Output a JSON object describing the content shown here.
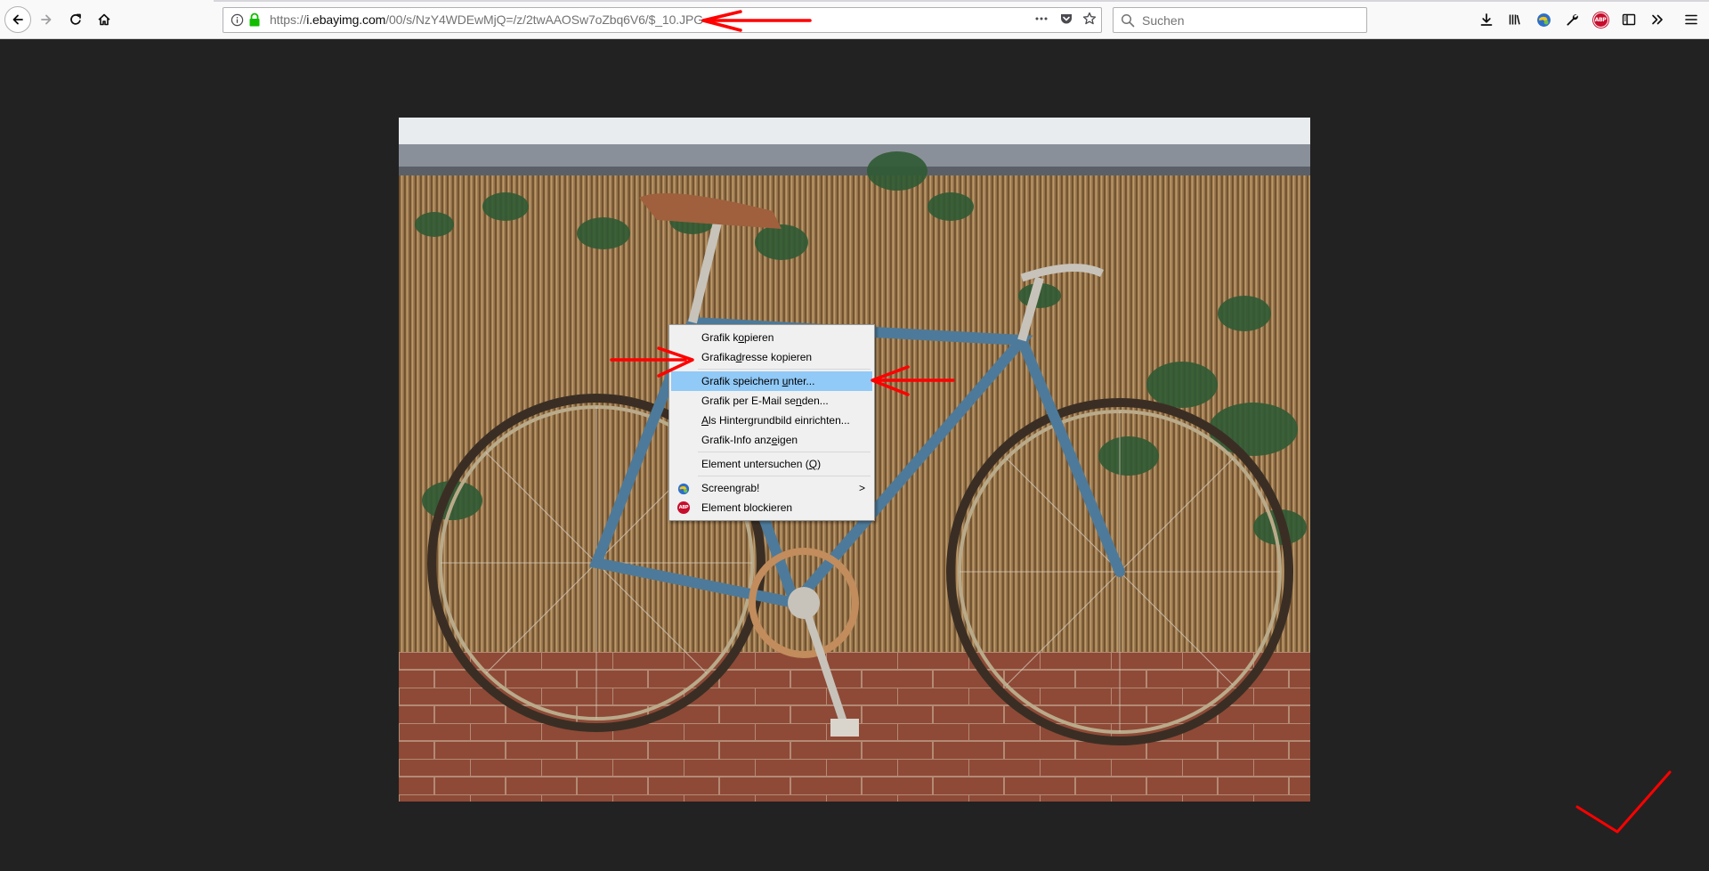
{
  "toolbar": {
    "url": {
      "scheme": "https://",
      "host": "i.ebayimg.com",
      "path": "/00/s/NzY4WDEwMjQ=/z/2twAAOSw7oZbq6V6/$_10.JPG"
    },
    "search": {
      "placeholder": "Suchen"
    },
    "icons": {
      "back": "back-arrow-icon",
      "forward": "forward-arrow-icon",
      "reload": "reload-icon",
      "home": "home-icon",
      "info": "info-icon",
      "lock": "lock-icon",
      "page_actions": "page-actions-icon",
      "pocket": "pocket-icon",
      "bookmark": "star-icon",
      "downloads": "download-icon",
      "library": "library-icon",
      "screengrab": "screengrab-icon",
      "tools": "wrench-icon",
      "adblock": "abp-icon",
      "sidebar": "sidebar-icon",
      "overflow": "overflow-chevrons-icon",
      "menu": "hamburger-menu-icon"
    },
    "abp_badge": "ABP"
  },
  "context_menu": {
    "items": [
      {
        "pre": "Grafik k",
        "acc": "o",
        "post": "pieren"
      },
      {
        "pre": "Grafika",
        "acc": "d",
        "post": "resse kopieren"
      },
      {
        "pre": "Grafik speichern ",
        "acc": "u",
        "post": "nter..."
      },
      {
        "pre": "Grafik per E-Mail se",
        "acc": "n",
        "post": "den..."
      },
      {
        "pre": "",
        "acc": "A",
        "post": "ls Hintergrundbild einrichten..."
      },
      {
        "pre": "Grafik-Info anz",
        "acc": "e",
        "post": "igen"
      },
      {
        "pre": "Element untersuchen (",
        "acc": "Q",
        "post": ")"
      },
      {
        "pre": "Screengrab!",
        "acc": "",
        "post": "",
        "submenu": ">"
      },
      {
        "pre": "Element blockieren",
        "acc": "",
        "post": ""
      }
    ],
    "abp_badge": "ABP"
  },
  "colors": {
    "annotation": "#ff0000",
    "menu_highlight": "#91c9f7",
    "background": "#222222"
  }
}
